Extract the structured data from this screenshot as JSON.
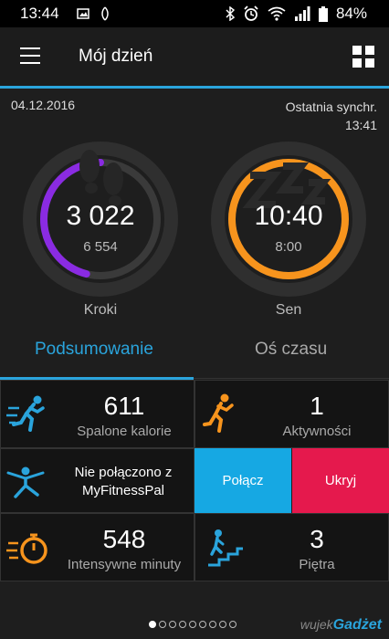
{
  "status_bar": {
    "time": "13:44",
    "battery": "84%"
  },
  "header": {
    "title": "Mój dzień"
  },
  "summary": {
    "date": "04.12.2016",
    "sync_label": "Ostatnia synchr.",
    "sync_time": "13:41"
  },
  "rings": {
    "steps": {
      "value": "3 022",
      "goal": "6 554",
      "label": "Kroki",
      "progress": 0.46,
      "color": "#8a2be2"
    },
    "sleep": {
      "value": "10:40",
      "goal": "8:00",
      "label": "Sen",
      "progress": 1.0,
      "color": "#f7941d"
    }
  },
  "tabs": [
    {
      "label": "Podsumowanie",
      "active": true
    },
    {
      "label": "Oś czasu",
      "active": false
    }
  ],
  "tiles": {
    "calories": {
      "value": "611",
      "label": "Spalone kalorie"
    },
    "activities": {
      "value": "1",
      "label": "Aktywności"
    },
    "mfp": {
      "text_line1": "Nie połączono z",
      "text_line2": "MyFitnessPal",
      "connect_label": "Połącz",
      "hide_label": "Ukryj"
    },
    "intensity": {
      "value": "548",
      "label": "Intensywne minuty"
    },
    "floors": {
      "value": "3",
      "label": "Piętra"
    }
  },
  "pager": {
    "count": 9,
    "active_index": 0
  },
  "watermark": {
    "prefix": "wujek",
    "brand": "Gadżet"
  },
  "colors": {
    "accent": "#2aa4dc",
    "connect": "#16a8e3",
    "hide": "#e5194d",
    "orange": "#f7941d"
  }
}
